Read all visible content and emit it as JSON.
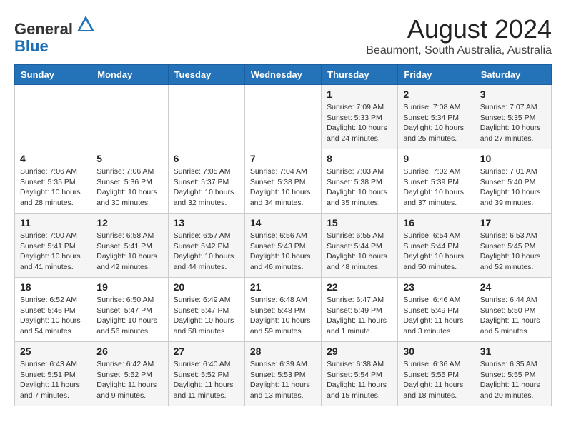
{
  "header": {
    "logo_general": "General",
    "logo_blue": "Blue",
    "month_year": "August 2024",
    "location": "Beaumont, South Australia, Australia"
  },
  "weekdays": [
    "Sunday",
    "Monday",
    "Tuesday",
    "Wednesday",
    "Thursday",
    "Friday",
    "Saturday"
  ],
  "weeks": [
    [
      {
        "num": "",
        "info": ""
      },
      {
        "num": "",
        "info": ""
      },
      {
        "num": "",
        "info": ""
      },
      {
        "num": "",
        "info": ""
      },
      {
        "num": "1",
        "info": "Sunrise: 7:09 AM\nSunset: 5:33 PM\nDaylight: 10 hours\nand 24 minutes."
      },
      {
        "num": "2",
        "info": "Sunrise: 7:08 AM\nSunset: 5:34 PM\nDaylight: 10 hours\nand 25 minutes."
      },
      {
        "num": "3",
        "info": "Sunrise: 7:07 AM\nSunset: 5:35 PM\nDaylight: 10 hours\nand 27 minutes."
      }
    ],
    [
      {
        "num": "4",
        "info": "Sunrise: 7:06 AM\nSunset: 5:35 PM\nDaylight: 10 hours\nand 28 minutes."
      },
      {
        "num": "5",
        "info": "Sunrise: 7:06 AM\nSunset: 5:36 PM\nDaylight: 10 hours\nand 30 minutes."
      },
      {
        "num": "6",
        "info": "Sunrise: 7:05 AM\nSunset: 5:37 PM\nDaylight: 10 hours\nand 32 minutes."
      },
      {
        "num": "7",
        "info": "Sunrise: 7:04 AM\nSunset: 5:38 PM\nDaylight: 10 hours\nand 34 minutes."
      },
      {
        "num": "8",
        "info": "Sunrise: 7:03 AM\nSunset: 5:38 PM\nDaylight: 10 hours\nand 35 minutes."
      },
      {
        "num": "9",
        "info": "Sunrise: 7:02 AM\nSunset: 5:39 PM\nDaylight: 10 hours\nand 37 minutes."
      },
      {
        "num": "10",
        "info": "Sunrise: 7:01 AM\nSunset: 5:40 PM\nDaylight: 10 hours\nand 39 minutes."
      }
    ],
    [
      {
        "num": "11",
        "info": "Sunrise: 7:00 AM\nSunset: 5:41 PM\nDaylight: 10 hours\nand 41 minutes."
      },
      {
        "num": "12",
        "info": "Sunrise: 6:58 AM\nSunset: 5:41 PM\nDaylight: 10 hours\nand 42 minutes."
      },
      {
        "num": "13",
        "info": "Sunrise: 6:57 AM\nSunset: 5:42 PM\nDaylight: 10 hours\nand 44 minutes."
      },
      {
        "num": "14",
        "info": "Sunrise: 6:56 AM\nSunset: 5:43 PM\nDaylight: 10 hours\nand 46 minutes."
      },
      {
        "num": "15",
        "info": "Sunrise: 6:55 AM\nSunset: 5:44 PM\nDaylight: 10 hours\nand 48 minutes."
      },
      {
        "num": "16",
        "info": "Sunrise: 6:54 AM\nSunset: 5:44 PM\nDaylight: 10 hours\nand 50 minutes."
      },
      {
        "num": "17",
        "info": "Sunrise: 6:53 AM\nSunset: 5:45 PM\nDaylight: 10 hours\nand 52 minutes."
      }
    ],
    [
      {
        "num": "18",
        "info": "Sunrise: 6:52 AM\nSunset: 5:46 PM\nDaylight: 10 hours\nand 54 minutes."
      },
      {
        "num": "19",
        "info": "Sunrise: 6:50 AM\nSunset: 5:47 PM\nDaylight: 10 hours\nand 56 minutes."
      },
      {
        "num": "20",
        "info": "Sunrise: 6:49 AM\nSunset: 5:47 PM\nDaylight: 10 hours\nand 58 minutes."
      },
      {
        "num": "21",
        "info": "Sunrise: 6:48 AM\nSunset: 5:48 PM\nDaylight: 10 hours\nand 59 minutes."
      },
      {
        "num": "22",
        "info": "Sunrise: 6:47 AM\nSunset: 5:49 PM\nDaylight: 11 hours\nand 1 minute."
      },
      {
        "num": "23",
        "info": "Sunrise: 6:46 AM\nSunset: 5:49 PM\nDaylight: 11 hours\nand 3 minutes."
      },
      {
        "num": "24",
        "info": "Sunrise: 6:44 AM\nSunset: 5:50 PM\nDaylight: 11 hours\nand 5 minutes."
      }
    ],
    [
      {
        "num": "25",
        "info": "Sunrise: 6:43 AM\nSunset: 5:51 PM\nDaylight: 11 hours\nand 7 minutes."
      },
      {
        "num": "26",
        "info": "Sunrise: 6:42 AM\nSunset: 5:52 PM\nDaylight: 11 hours\nand 9 minutes."
      },
      {
        "num": "27",
        "info": "Sunrise: 6:40 AM\nSunset: 5:52 PM\nDaylight: 11 hours\nand 11 minutes."
      },
      {
        "num": "28",
        "info": "Sunrise: 6:39 AM\nSunset: 5:53 PM\nDaylight: 11 hours\nand 13 minutes."
      },
      {
        "num": "29",
        "info": "Sunrise: 6:38 AM\nSunset: 5:54 PM\nDaylight: 11 hours\nand 15 minutes."
      },
      {
        "num": "30",
        "info": "Sunrise: 6:36 AM\nSunset: 5:55 PM\nDaylight: 11 hours\nand 18 minutes."
      },
      {
        "num": "31",
        "info": "Sunrise: 6:35 AM\nSunset: 5:55 PM\nDaylight: 11 hours\nand 20 minutes."
      }
    ]
  ]
}
